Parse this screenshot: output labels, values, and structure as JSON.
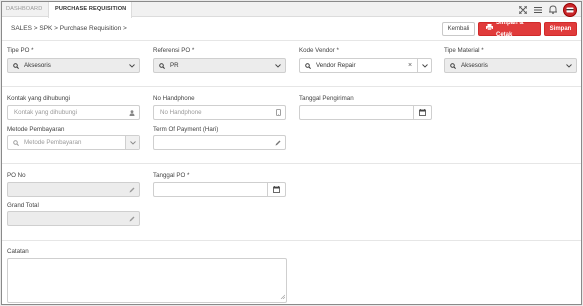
{
  "tabs": {
    "dashboard": "DASHBOARD",
    "active": "PURCHASE REQUISITION",
    "close": "×"
  },
  "breadcrumb": "SALES > SPK > Purchase Requisition >",
  "buttons": {
    "back": "Kembali",
    "save_print": "Simpan & Cetak",
    "save": "Simpan"
  },
  "form": {
    "tipe_po": {
      "label": "Tipe PO *",
      "value": "Aksesoris"
    },
    "referensi_po": {
      "label": "Referensi PO *",
      "value": "PR"
    },
    "kode_vendor": {
      "label": "Kode Vendor *",
      "value": "Vendor Repair"
    },
    "tipe_material": {
      "label": "Tipe Material *",
      "value": "Aksesoris"
    },
    "kontak": {
      "label": "Kontak yang dihubungi",
      "placeholder": "Kontak yang dihubungi"
    },
    "no_hp": {
      "label": "No Handphone",
      "placeholder": "No Handphone"
    },
    "tanggal_pengiriman": {
      "label": "Tanggal Pengiriman",
      "value": ""
    },
    "metode_pembayaran": {
      "label": "Metode Pembayaran",
      "placeholder": "Metode Pembayaran"
    },
    "term_of_payment": {
      "label": "Term Of Payment (Hari)",
      "value": ""
    },
    "po_no": {
      "label": "PO No",
      "value": ""
    },
    "tanggal_po": {
      "label": "Tanggal PO *",
      "value": ""
    },
    "grand_total": {
      "label": "Grand Total",
      "value": ""
    },
    "catatan": {
      "label": "Catatan",
      "value": ""
    }
  },
  "colors": {
    "accent": "#e03b3b",
    "border": "#cfcfcf",
    "disabled": "#ececec"
  },
  "icons": [
    "expand-icon",
    "menu-icon",
    "bell-icon",
    "avatar",
    "search-icon",
    "chevron-down-icon",
    "clear-icon",
    "user-icon",
    "phone-icon",
    "calendar-icon",
    "pencil-icon",
    "printer-icon"
  ]
}
